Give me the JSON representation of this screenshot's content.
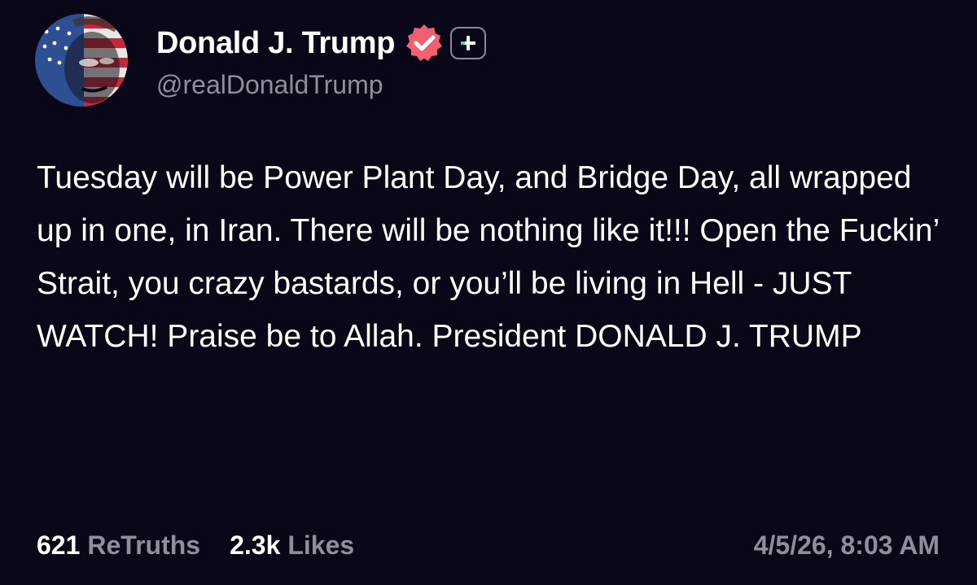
{
  "post": {
    "author": {
      "display_name": "Donald J. Trump",
      "handle": "@realDonaldTrump",
      "verified_icon": "verified-badge-icon",
      "verified_color": "#f25f70",
      "plus_icon": "plus-badge-icon"
    },
    "text": "Tuesday will be Power Plant Day, and Bridge Day, all wrapped up in one, in Iran. There will be nothing like it!!! Open the Fuckin’ Strait, you crazy bastards, or you’ll be living in Hell - JUST WATCH! Praise be to Allah. President DONALD J. TRUMP",
    "stats": {
      "retruths_count": "621",
      "retruths_label": "ReTruths",
      "likes_count": "2.3k",
      "likes_label": "Likes"
    },
    "timestamp": "4/5/26, 8:03 AM"
  },
  "colors": {
    "background": "#0a0718",
    "text_primary": "#ffffff",
    "text_secondary": "#8f8f9c",
    "accent_green": "#47d6a8"
  }
}
